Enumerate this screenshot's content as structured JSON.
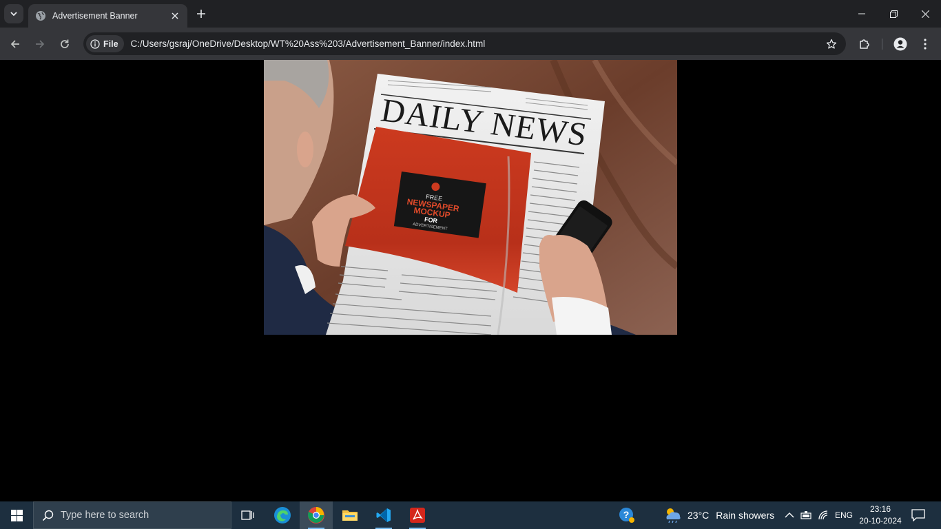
{
  "browser": {
    "tab": {
      "title": "Advertisement Banner"
    },
    "address_bar": {
      "chip_label": "File",
      "url": "C:/Users/gsraj/OneDrive/Desktop/WT%20Ass%203/Advertisement_Banner/index.html"
    }
  },
  "page": {
    "banner": {
      "headline": "DAILY NEWS",
      "ad_line1": "FREE",
      "ad_line2": "NEWSPAPER",
      "ad_line3": "MOCKUP",
      "ad_line4": "FOR",
      "ad_line5": "ADVERTISEMENT"
    }
  },
  "taskbar": {
    "search_placeholder": "Type here to search",
    "weather": {
      "temp": "23°C",
      "condition": "Rain showers"
    },
    "language": "ENG",
    "time": "23:16",
    "date": "20-10-2024"
  },
  "colors": {
    "titlebar": "#202124",
    "toolbar": "#35363a",
    "taskbar": "#1d2f3f",
    "ad_red": "#cc3a1f"
  }
}
